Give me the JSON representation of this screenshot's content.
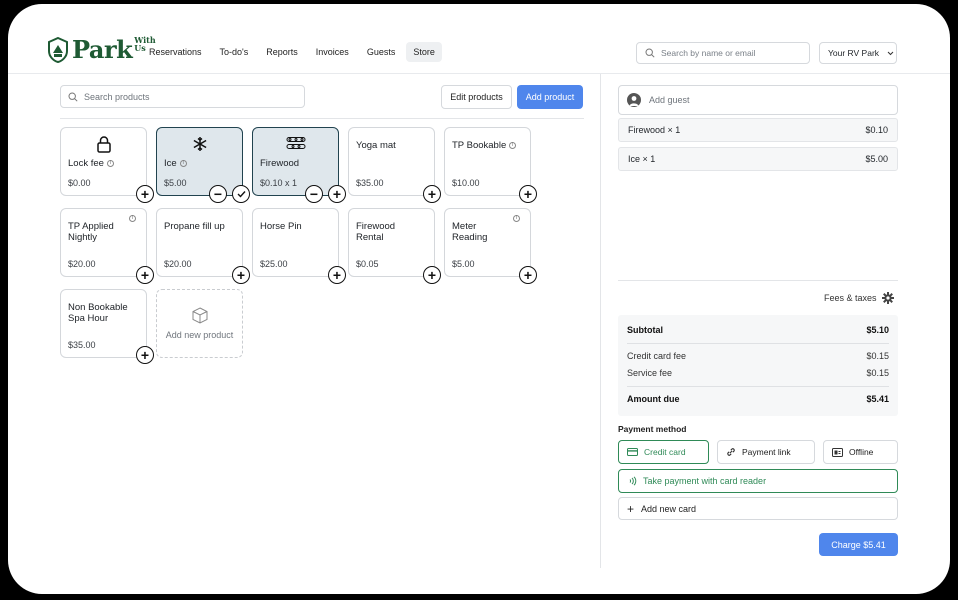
{
  "header": {
    "logo_text": "Park",
    "logo_small": "With Us",
    "nav": [
      "Reservations",
      "To-do's",
      "Reports",
      "Invoices",
      "Guests",
      "Store"
    ],
    "active_nav": "Store",
    "search_placeholder": "Search by name or email",
    "park_select": "Your RV Park"
  },
  "products_pane": {
    "search_placeholder": "Search products",
    "edit_label": "Edit products",
    "add_label": "Add product",
    "cards": [
      {
        "name": "Lock fee",
        "price": "$0.00",
        "icon": "lock-icon",
        "info": true
      },
      {
        "name": "Ice",
        "price": "$5.00",
        "icon": "snowflake-icon",
        "info": true,
        "selected": true
      },
      {
        "name": "Firewood",
        "price": "$0.10 x 1",
        "icon": "firewood-icon",
        "selected": true
      },
      {
        "name": "Yoga mat",
        "price": "$35.00"
      },
      {
        "name": "TP Bookable",
        "price": "$10.00",
        "info": true
      },
      {
        "name": "TP Applied Nightly",
        "price": "$20.00",
        "info": true
      },
      {
        "name": "Propane fill up",
        "price": "$20.00"
      },
      {
        "name": "Horse Pin",
        "price": "$25.00"
      },
      {
        "name": "Firewood Rental",
        "price": "$0.05"
      },
      {
        "name": "Meter Reading",
        "price": "$5.00",
        "info": true
      },
      {
        "name": "Non Bookable Spa Hour",
        "price": "$35.00"
      }
    ],
    "add_new_label": "Add new product"
  },
  "cart": {
    "add_guest_label": "Add guest",
    "items": [
      {
        "label": "Firewood × 1",
        "price": "$0.10"
      },
      {
        "label": "Ice × 1",
        "price": "$5.00"
      }
    ],
    "fees_label": "Fees & taxes",
    "summary": {
      "subtotal_label": "Subtotal",
      "subtotal": "$5.10",
      "cc_fee_label": "Credit card fee",
      "cc_fee": "$0.15",
      "service_fee_label": "Service fee",
      "service_fee": "$0.15",
      "due_label": "Amount due",
      "due": "$5.41"
    },
    "payment_method_label": "Payment method",
    "methods": [
      "Credit card",
      "Payment link",
      "Offline"
    ],
    "selected_method": "Credit card",
    "reader_label": "Take payment with card reader",
    "new_card_label": "Add new card",
    "charge_label": "Charge $5.41"
  },
  "colors": {
    "brand_green": "#1e5a33",
    "accent_blue": "#4f86ec",
    "success_green": "#2f8a57",
    "selected_card_bg": "#dfe7ec"
  }
}
